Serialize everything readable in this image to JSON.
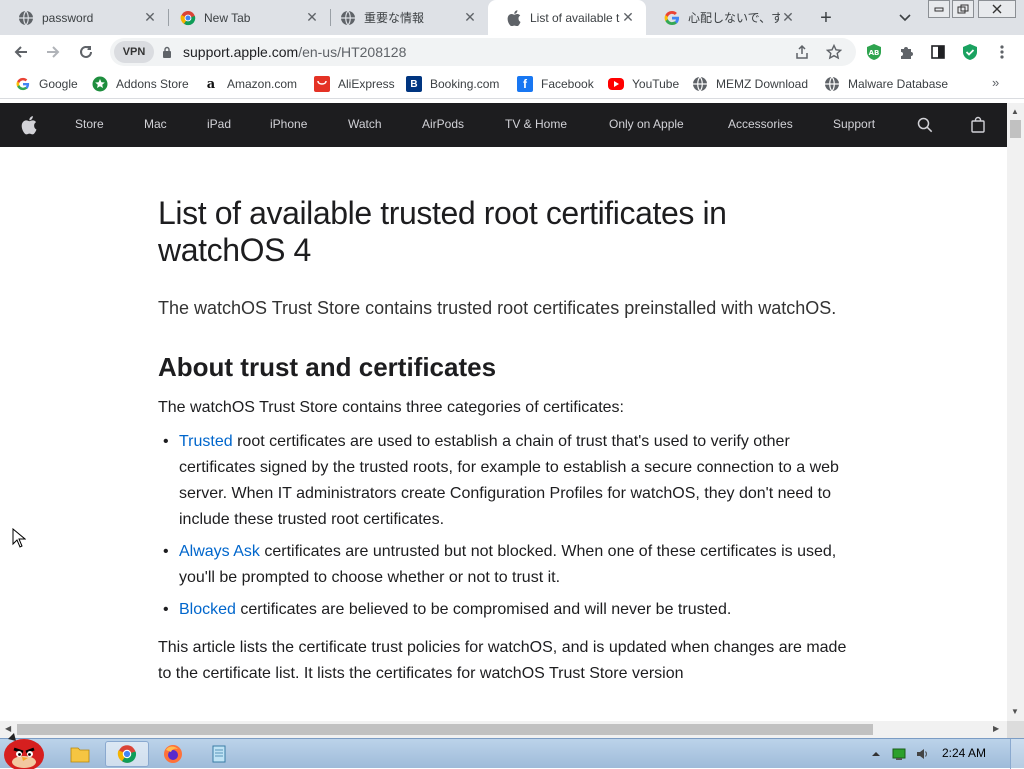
{
  "browser": {
    "tabs": [
      {
        "title": "password",
        "icon": "globe-icon",
        "active": false
      },
      {
        "title": "New Tab",
        "icon": "chrome-icon",
        "active": false
      },
      {
        "title": "重要な情報",
        "icon": "globe-icon",
        "active": false
      },
      {
        "title": "List of available tr",
        "icon": "apple-icon",
        "active": true
      },
      {
        "title": "心配しないで、す",
        "icon": "google-icon",
        "active": false
      }
    ],
    "new_tab_label": "+",
    "tab_search_label": "⌄",
    "window_controls": {
      "minimize": "▭",
      "restore": "⧉",
      "close": "✕"
    }
  },
  "toolbar": {
    "vpn_label": "VPN",
    "url_domain": "support.apple.com",
    "url_path": "/en-us/HT208128",
    "extensions": [
      {
        "name": "adblock-extension-icon",
        "label": "AB",
        "color": "#2ea44f"
      },
      {
        "name": "puzzle-extension-icon",
        "label": "",
        "color": "#5f6368"
      },
      {
        "name": "sidepanel-icon",
        "label": "",
        "color": "#202124"
      },
      {
        "name": "shield-extension-icon",
        "label": "✓",
        "color": "#1aa260"
      }
    ]
  },
  "bookmarks": {
    "items": [
      {
        "label": "Google",
        "icon": "google-icon",
        "color": "#4285f4"
      },
      {
        "label": "Addons Store",
        "icon": "addons-icon",
        "color": "#1e8e3e"
      },
      {
        "label": "Amazon.com",
        "icon": "amazon-icon",
        "color": "#ffffff"
      },
      {
        "label": "AliExpress",
        "icon": "aliexpress-icon",
        "color": "#e43225"
      },
      {
        "label": "Booking.com",
        "icon": "booking-icon",
        "color": "#003580"
      },
      {
        "label": "Facebook",
        "icon": "facebook-icon",
        "color": "#1877f2"
      },
      {
        "label": "YouTube",
        "icon": "youtube-icon",
        "color": "#ff0000"
      },
      {
        "label": "MEMZ Download",
        "icon": "globe-icon",
        "color": "#5f6368"
      },
      {
        "label": "Malware Database",
        "icon": "globe-icon",
        "color": "#5f6368"
      }
    ],
    "more_label": "»"
  },
  "apple_nav": {
    "items": [
      "Store",
      "Mac",
      "iPad",
      "iPhone",
      "Watch",
      "AirPods",
      "TV & Home",
      "Only on Apple",
      "Accessories",
      "Support"
    ]
  },
  "article": {
    "title": "List of available trusted root certificates in watchOS 4",
    "lede": "The watchOS Trust Store contains trusted root certificates preinstalled with watchOS.",
    "section_title": "About trust and certificates",
    "intro": "The watchOS Trust Store contains three categories of certificates:",
    "bullets": [
      {
        "link": "Trusted",
        "text": " root certificates are used to establish a chain of trust that's used to verify other certificates signed by the trusted roots, for example to establish a secure connection to a web server. When IT administrators create Configuration Profiles for watchOS, they don't need to include these trusted root certificates."
      },
      {
        "link": "Always Ask",
        "text": " certificates are untrusted but not blocked. When one of these certificates is used, you'll be prompted to choose whether or not to trust it."
      },
      {
        "link": "Blocked",
        "text": " certificates are believed to be compromised and will never be trusted."
      }
    ],
    "closing": "This article lists the certificate trust policies for watchOS, and is updated when changes are made to the certificate list. It lists the certificates for watchOS Trust Store version"
  },
  "taskbar": {
    "clock": "2:24 AM"
  },
  "colors": {
    "link": "#0066cc",
    "apple_nav_bg": "#1d1d1f",
    "tabstrip_bg": "#dee1e6"
  }
}
